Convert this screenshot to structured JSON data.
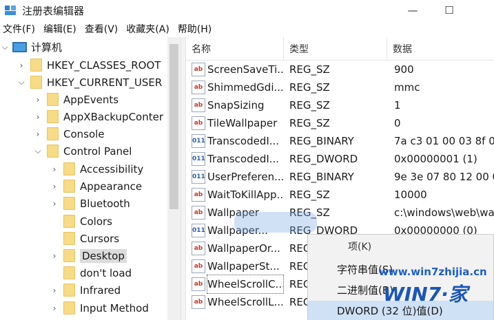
{
  "window": {
    "title": "注册表编辑器",
    "minimize": "—",
    "maximize": "☐"
  },
  "menu": [
    "文件(F)",
    "编辑(E)",
    "查看(V)",
    "收藏夹(A)",
    "帮助(H)"
  ],
  "tree": {
    "root": "计算机",
    "items": [
      "HKEY_CLASSES_ROOT",
      "HKEY_CURRENT_USER",
      "AppEvents",
      "AppXBackupConter",
      "Console",
      "Control Panel",
      "Accessibility",
      "Appearance",
      "Bluetooth",
      "Colors",
      "Cursors",
      "Desktop",
      "don't load",
      "Infrared",
      "Input Method"
    ],
    "selected": "Desktop"
  },
  "list": {
    "headers": [
      "名称",
      "类型",
      "数据"
    ],
    "rows": [
      {
        "name": "ScreenSaveTi...",
        "type": "REG_SZ",
        "data": "900"
      },
      {
        "name": "ShimmedGdi...",
        "type": "REG_SZ",
        "data": "mmc"
      },
      {
        "name": "SnapSizing",
        "type": "REG_SZ",
        "data": "1"
      },
      {
        "name": "TileWallpaper",
        "type": "REG_SZ",
        "data": "0"
      },
      {
        "name": "TranscodedI...",
        "type": "REG_BINARY",
        "data": "7a c3 01 00 03 8f 0"
      },
      {
        "name": "TranscodedI...",
        "type": "REG_DWORD",
        "data": "0x00000001 (1)"
      },
      {
        "name": "UserPreferen...",
        "type": "REG_BINARY",
        "data": "9e 3e 07 80 12 00 0"
      },
      {
        "name": "WaitToKillApp...",
        "type": "REG_SZ",
        "data": "10000"
      },
      {
        "name": "Wallpaper",
        "type": "REG_SZ",
        "data": "c:\\windows\\web\\wa"
      },
      {
        "name": "Wallpaper...",
        "type": "REG_DWORD",
        "data": "0x00000000 (0)"
      },
      {
        "name": "WallpaperOr...",
        "type": "REG",
        "data": ""
      },
      {
        "name": "WallpaperSt...",
        "type": "REG",
        "data": ""
      },
      {
        "name": "WheelScrollC...",
        "type": "REG",
        "data": ""
      },
      {
        "name": "WheelScrollL...",
        "type": "REG",
        "data": ""
      }
    ]
  },
  "context_menu": {
    "partial_top": "项(K)",
    "items": [
      "字符串值(S)",
      "二进制值(B)",
      "DWORD (32 位)值(D)"
    ],
    "hovered": "DWORD (32 位)值(D)"
  },
  "watermark": {
    "url": "www.win7zhijia.cn",
    "logo": "WIN7·家"
  }
}
